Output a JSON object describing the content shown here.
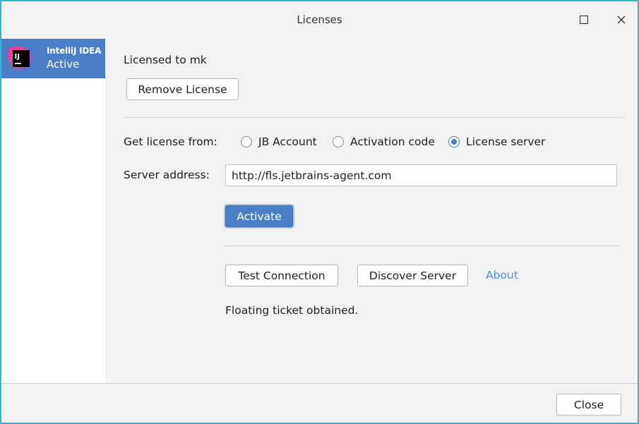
{
  "window": {
    "title": "Licenses",
    "border_color": "#2ab8d6"
  },
  "sidebar": {
    "items": [
      {
        "product": "IntelliJ IDEA",
        "status": "Active",
        "icon": "intellij-idea-logo",
        "logo_text": "IJ",
        "selected": true
      }
    ],
    "selected_color": "#4a7fc8"
  },
  "license": {
    "licensed_to": "Licensed to mk",
    "remove_label": "Remove License"
  },
  "get_license": {
    "label": "Get license from:",
    "options": [
      {
        "label": "JB Account",
        "checked": false
      },
      {
        "label": "Activation code",
        "checked": false
      },
      {
        "label": "License server",
        "checked": true
      }
    ]
  },
  "server": {
    "label": "Server address:",
    "value": "http://fls.jetbrains-agent.com"
  },
  "actions": {
    "activate_label": "Activate",
    "test_label": "Test Connection",
    "discover_label": "Discover Server",
    "about_label": "About"
  },
  "status_message": "Floating ticket obtained.",
  "footer": {
    "close_label": "Close"
  },
  "colors": {
    "accent": "#4a7fc8",
    "link": "#4a90e2"
  }
}
